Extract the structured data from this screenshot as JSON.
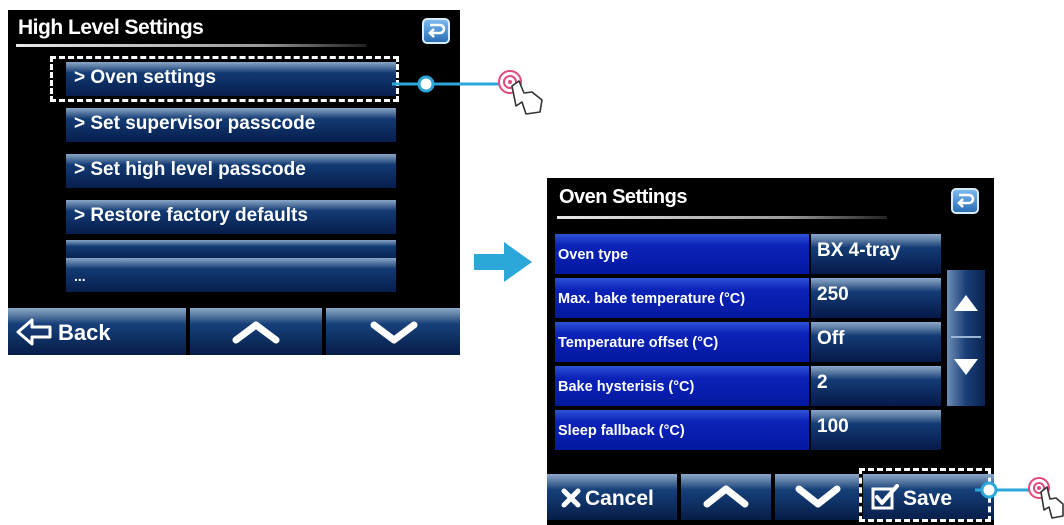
{
  "screen1": {
    "title": "High Level Settings",
    "back_icon": "return-icon",
    "menu_items": [
      {
        "label": "> Oven settings"
      },
      {
        "label": "> Set supervisor passcode"
      },
      {
        "label": "> Set high level passcode"
      },
      {
        "label": "> Restore factory defaults"
      },
      {
        "label": ""
      },
      {
        "label": "..."
      }
    ],
    "bottom": {
      "back_label": "Back",
      "up_icon": "chevron-up-icon",
      "down_icon": "chevron-down-icon"
    }
  },
  "flow_arrow_icon": "arrow-right-icon",
  "screen2": {
    "title": "Oven Settings",
    "back_icon": "return-icon",
    "rows": [
      {
        "label": "Oven type",
        "value": "BX 4-tray"
      },
      {
        "label": "Max. bake temperature (°C)",
        "value": "250"
      },
      {
        "label": "Temperature offset (°C)",
        "value": "Off"
      },
      {
        "label": "Bake hysterisis (°C)",
        "value": "2"
      },
      {
        "label": "Sleep fallback (°C)",
        "value": "100"
      }
    ],
    "scroll_up_icon": "triangle-up-icon",
    "scroll_down_icon": "triangle-down-icon",
    "bottom": {
      "cancel_label": "Cancel",
      "save_label": "Save",
      "up_icon": "chevron-up-icon",
      "down_icon": "chevron-down-icon"
    }
  },
  "colors": {
    "screen_bg": "#000000",
    "label_blue": "#0b22b8",
    "button_navy": "#071d48",
    "accent_cyan": "#2ba7d9"
  }
}
